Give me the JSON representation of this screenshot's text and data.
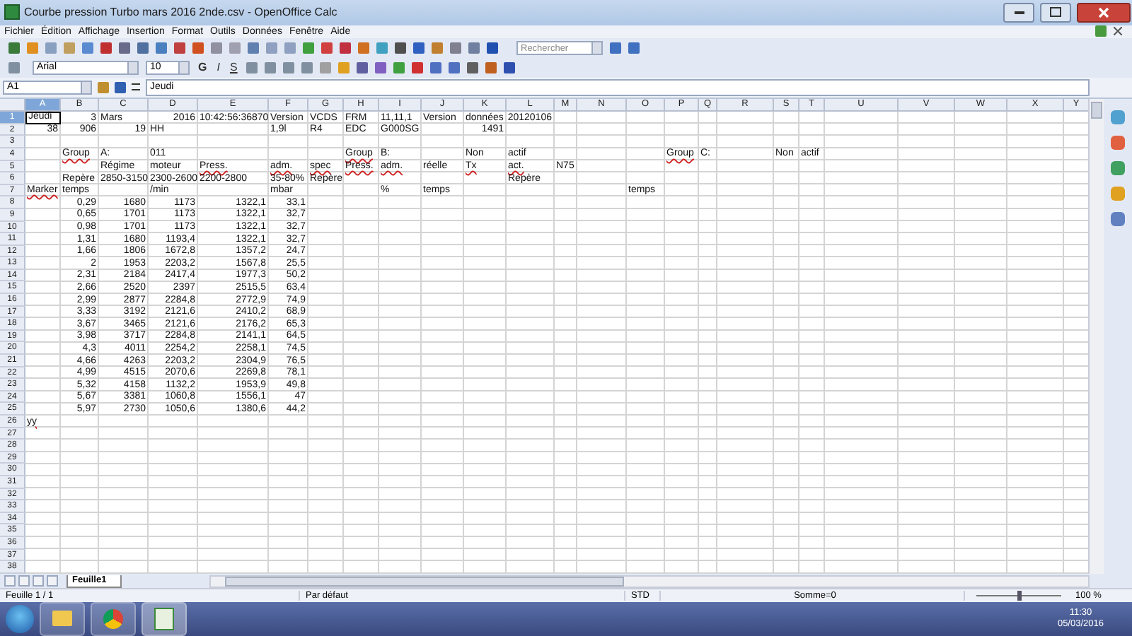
{
  "window": {
    "title": "Courbe pression Turbo mars 2016 2nde.csv - OpenOffice Calc"
  },
  "menu": [
    "Fichier",
    "Édition",
    "Affichage",
    "Insertion",
    "Format",
    "Outils",
    "Données",
    "Fenêtre",
    "Aide"
  ],
  "format_bar": {
    "font": "Arial",
    "size": "10",
    "bold": "G",
    "italic": "I",
    "underline": "S"
  },
  "search": {
    "placeholder": "Rechercher"
  },
  "formula_bar": {
    "cell": "A1",
    "value": "Jeudi"
  },
  "columns": [
    {
      "label": "A",
      "selected": true
    },
    {
      "label": "B",
      "selected": false
    },
    {
      "label": "C",
      "selected": false
    },
    {
      "label": "D",
      "selected": false
    },
    {
      "label": "E",
      "selected": false
    },
    {
      "label": "F",
      "selected": false
    },
    {
      "label": "G",
      "selected": false
    },
    {
      "label": "H",
      "selected": false
    },
    {
      "label": "I",
      "selected": false
    },
    {
      "label": "J",
      "selected": false
    },
    {
      "label": "K",
      "selected": false
    },
    {
      "label": "L",
      "selected": false
    },
    {
      "label": "M",
      "selected": false
    },
    {
      "label": "N",
      "selected": false
    },
    {
      "label": "O",
      "selected": false
    },
    {
      "label": "P",
      "selected": false
    },
    {
      "label": "Q",
      "selected": false
    },
    {
      "label": "R",
      "selected": false
    },
    {
      "label": "S",
      "selected": false
    },
    {
      "label": "T",
      "selected": false
    },
    {
      "label": "U",
      "selected": false
    },
    {
      "label": "V",
      "selected": false
    },
    {
      "label": "W",
      "selected": false
    },
    {
      "label": "X",
      "selected": false
    },
    {
      "label": "Y",
      "selected": false
    }
  ],
  "rows": [
    {
      "number": "1",
      "selected": true,
      "kind": "text",
      "cells": [
        "Jeudi",
        {
          "text": "3",
          "right_aligned": true
        },
        "Mars",
        {
          "text": "2016",
          "right_aligned": true
        },
        "10:42:56:36870",
        "Version",
        "VCDS",
        "FRM",
        "11,11,1",
        "Version",
        "données",
        {
          "text": "20120106",
          "right_aligned": true
        }
      ]
    },
    {
      "number": "2",
      "selected": false,
      "kind": "text",
      "cells": [
        {
          "text": "38",
          "right_aligned": true
        },
        {
          "text": "906",
          "right_aligned": true
        },
        {
          "text": "19",
          "right_aligned": true
        },
        "HH",
        null,
        "1,9l",
        "R4",
        "EDC",
        "G000SG",
        null,
        {
          "text": "1491",
          "right_aligned": true
        }
      ]
    },
    {
      "number": "3",
      "selected": false,
      "kind": "text",
      "cells": []
    },
    {
      "number": "4",
      "selected": false,
      "kind": "text",
      "cells": [
        null,
        {
          "text": "Group",
          "spell_error": true
        },
        "A:",
        "011",
        null,
        null,
        null,
        {
          "text": "Group",
          "spell_error": true
        },
        "B:",
        null,
        "Non",
        "actif",
        null,
        null,
        null,
        {
          "text": "Group",
          "spell_error": true
        },
        "C:",
        null,
        "Non",
        "actif"
      ]
    },
    {
      "number": "5",
      "selected": false,
      "kind": "text",
      "cells": [
        null,
        null,
        "Régime",
        "moteur",
        {
          "text": "Press.",
          "spell_error": true
        },
        {
          "text": "adm.",
          "spell_error": true
        },
        {
          "text": "spec",
          "spell_error": true
        },
        {
          "text": "Press.",
          "spell_error": true
        },
        {
          "text": "adm.",
          "spell_error": true
        },
        "réelle",
        {
          "text": "Tx",
          "spell_error": true
        },
        {
          "text": "act.",
          "spell_error": true
        },
        "N75"
      ]
    },
    {
      "number": "6",
      "selected": false,
      "kind": "text",
      "cells": [
        null,
        "Repère",
        "2850-3150",
        "2300-2600",
        "2200-2800",
        "35-80%",
        "Repère",
        null,
        null,
        null,
        null,
        "Repère"
      ]
    },
    {
      "number": "7",
      "selected": false,
      "kind": "text",
      "cells": [
        {
          "text": "Marker",
          "spell_error": true
        },
        "temps",
        null,
        "/min",
        null,
        "mbar",
        null,
        null,
        "%",
        "temps",
        null,
        null,
        null,
        null,
        "temps"
      ]
    },
    {
      "number": "8",
      "selected": false,
      "kind": "data",
      "values": [
        "0,29",
        "1680",
        "1173",
        "1322,1",
        "33,1"
      ]
    },
    {
      "number": "9",
      "selected": false,
      "kind": "data",
      "values": [
        "0,65",
        "1701",
        "1173",
        "1322,1",
        "32,7"
      ]
    },
    {
      "number": "10",
      "selected": false,
      "kind": "data",
      "values": [
        "0,98",
        "1701",
        "1173",
        "1322,1",
        "32,7"
      ]
    },
    {
      "number": "11",
      "selected": false,
      "kind": "data",
      "values": [
        "1,31",
        "1680",
        "1193,4",
        "1322,1",
        "32,7"
      ]
    },
    {
      "number": "12",
      "selected": false,
      "kind": "data",
      "values": [
        "1,66",
        "1806",
        "1672,8",
        "1357,2",
        "24,7"
      ]
    },
    {
      "number": "13",
      "selected": false,
      "kind": "data",
      "values": [
        "2",
        "1953",
        "2203,2",
        "1567,8",
        "25,5"
      ]
    },
    {
      "number": "14",
      "selected": false,
      "kind": "data",
      "values": [
        "2,31",
        "2184",
        "2417,4",
        "1977,3",
        "50,2"
      ]
    },
    {
      "number": "15",
      "selected": false,
      "kind": "data",
      "values": [
        "2,66",
        "2520",
        "2397",
        "2515,5",
        "63,4"
      ]
    },
    {
      "number": "16",
      "selected": false,
      "kind": "data",
      "values": [
        "2,99",
        "2877",
        "2284,8",
        "2772,9",
        "74,9"
      ]
    },
    {
      "number": "17",
      "selected": false,
      "kind": "data",
      "values": [
        "3,33",
        "3192",
        "2121,6",
        "2410,2",
        "68,9"
      ]
    },
    {
      "number": "18",
      "selected": false,
      "kind": "data",
      "values": [
        "3,67",
        "3465",
        "2121,6",
        "2176,2",
        "65,3"
      ]
    },
    {
      "number": "19",
      "selected": false,
      "kind": "data",
      "values": [
        "3,98",
        "3717",
        "2284,8",
        "2141,1",
        "64,5"
      ]
    },
    {
      "number": "20",
      "selected": false,
      "kind": "data",
      "values": [
        "4,3",
        "4011",
        "2254,2",
        "2258,1",
        "74,5"
      ]
    },
    {
      "number": "21",
      "selected": false,
      "kind": "data",
      "values": [
        "4,66",
        "4263",
        "2203,2",
        "2304,9",
        "76,5"
      ]
    },
    {
      "number": "22",
      "selected": false,
      "kind": "data",
      "values": [
        "4,99",
        "4515",
        "2070,6",
        "2269,8",
        "78,1"
      ]
    },
    {
      "number": "23",
      "selected": false,
      "kind": "data",
      "values": [
        "5,32",
        "4158",
        "1132,2",
        "1953,9",
        "49,8"
      ]
    },
    {
      "number": "24",
      "selected": false,
      "kind": "data",
      "values": [
        "5,67",
        "3381",
        "1060,8",
        "1556,1",
        "47"
      ]
    },
    {
      "number": "25",
      "selected": false,
      "kind": "data",
      "values": [
        "5,97",
        "2730",
        "1050,6",
        "1380,6",
        "44,2"
      ]
    },
    {
      "number": "26",
      "selected": false,
      "kind": "text",
      "cells": [
        {
          "text": "yy",
          "spell_error": true
        }
      ]
    },
    {
      "number": "27",
      "selected": false,
      "kind": "text",
      "cells": []
    },
    {
      "number": "28",
      "selected": false,
      "kind": "text",
      "cells": []
    },
    {
      "number": "29",
      "selected": false,
      "kind": "text",
      "cells": []
    },
    {
      "number": "30",
      "selected": false,
      "kind": "text",
      "cells": []
    },
    {
      "number": "31",
      "selected": false,
      "kind": "text",
      "cells": []
    },
    {
      "number": "32",
      "selected": false,
      "kind": "text",
      "cells": []
    },
    {
      "number": "33",
      "selected": false,
      "kind": "text",
      "cells": []
    },
    {
      "number": "34",
      "selected": false,
      "kind": "text",
      "cells": []
    },
    {
      "number": "35",
      "selected": false,
      "kind": "text",
      "cells": []
    },
    {
      "number": "36",
      "selected": false,
      "kind": "text",
      "cells": []
    },
    {
      "number": "37",
      "selected": false,
      "kind": "text",
      "cells": []
    },
    {
      "number": "38",
      "selected": false,
      "kind": "text",
      "cells": []
    }
  ],
  "sheet_tabs": [
    {
      "label": "Feuille1",
      "selected": true
    }
  ],
  "status_bar": {
    "sheet": "Feuille 1 / 1",
    "style": "Par défaut",
    "mode": "STD",
    "sum": "Somme=0",
    "zoom": "100 %",
    "zoom_slider": {
      "level": 0.5
    }
  },
  "taskbar": {
    "time": "11:30",
    "date": "05/03/2016"
  }
}
